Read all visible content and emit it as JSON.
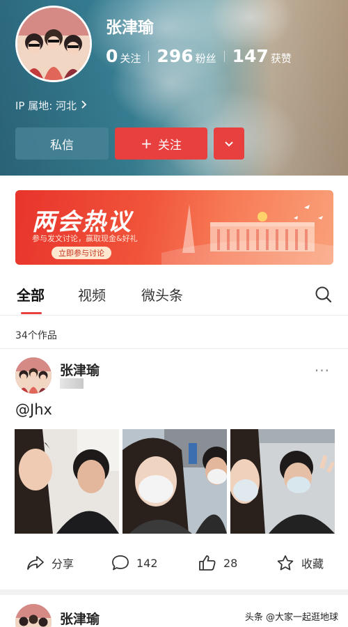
{
  "profile": {
    "name": "张津瑜",
    "stats": [
      {
        "value": "0",
        "label": "关注"
      },
      {
        "value": "296",
        "label": "粉丝"
      },
      {
        "value": "147",
        "label": "获赞"
      }
    ],
    "ip_location": "IP 属地: 河北",
    "message_label": "私信",
    "follow_label": "关注",
    "follow_icon": "plus-icon",
    "more_icon": "chevron-down-icon"
  },
  "banner": {
    "title": "两会热议",
    "subtitle": "参与发文讨论，赢取现金&好礼",
    "cta": "立即参与讨论"
  },
  "tabs": [
    {
      "label": "全部",
      "active": true
    },
    {
      "label": "视频",
      "active": false
    },
    {
      "label": "微头条",
      "active": false
    }
  ],
  "works_count": "34个作品",
  "post": {
    "author": "张津瑜",
    "more": "···",
    "text": "@Jhx",
    "photos": [
      "selfie-photo",
      "masked-selfie-photo",
      "car-selfie-photo"
    ],
    "actions": {
      "share_label": "分享",
      "comment_count": "142",
      "like_count": "28",
      "favorite_label": "收藏"
    }
  },
  "post2": {
    "author": "张津瑜"
  },
  "watermark": "头条 @大家一起逛地球",
  "colors": {
    "accent_red": "#e83f3f",
    "message_button": "#46829a"
  }
}
